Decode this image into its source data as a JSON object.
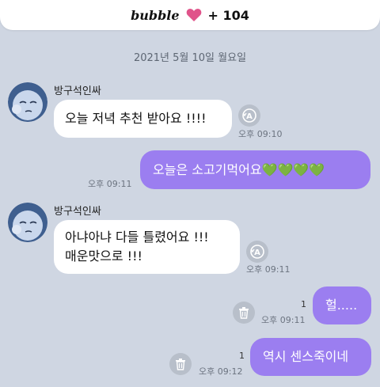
{
  "header": {
    "brand": "bubble",
    "count": "+ 104",
    "heart_color": "#e0538a"
  },
  "chat": {
    "date_separator": "2021년 5월 10일 월요일",
    "messages": [
      {
        "direction": "incoming",
        "sender": "방구석인싸",
        "text": "오늘 저녁 추천 받아요 !!!!",
        "time": "오후 09:10",
        "action_icon": "translate-icon"
      },
      {
        "direction": "outgoing",
        "text": "오늘은 소고기먹어요💚💚💚💚",
        "time": "오후 09:11"
      },
      {
        "direction": "incoming",
        "sender": "방구석인싸",
        "lines": [
          "아냐아냐 다들 틀렸어요 !!!",
          "매운맛으로 !!!"
        ],
        "time": "오후 09:11",
        "action_icon": "translate-icon"
      },
      {
        "direction": "outgoing",
        "text": "헐.....",
        "time": "오후 09:11",
        "unread": "1",
        "action_icon": "trash-icon"
      },
      {
        "direction": "outgoing",
        "text": "역시 센스죽이네",
        "time": "오후 09:12",
        "unread": "1",
        "action_icon": "trash-icon"
      }
    ]
  },
  "colors": {
    "background": "#cfd6e2",
    "outgoing_bubble": "#9b7ef0",
    "incoming_bubble": "#ffffff"
  }
}
